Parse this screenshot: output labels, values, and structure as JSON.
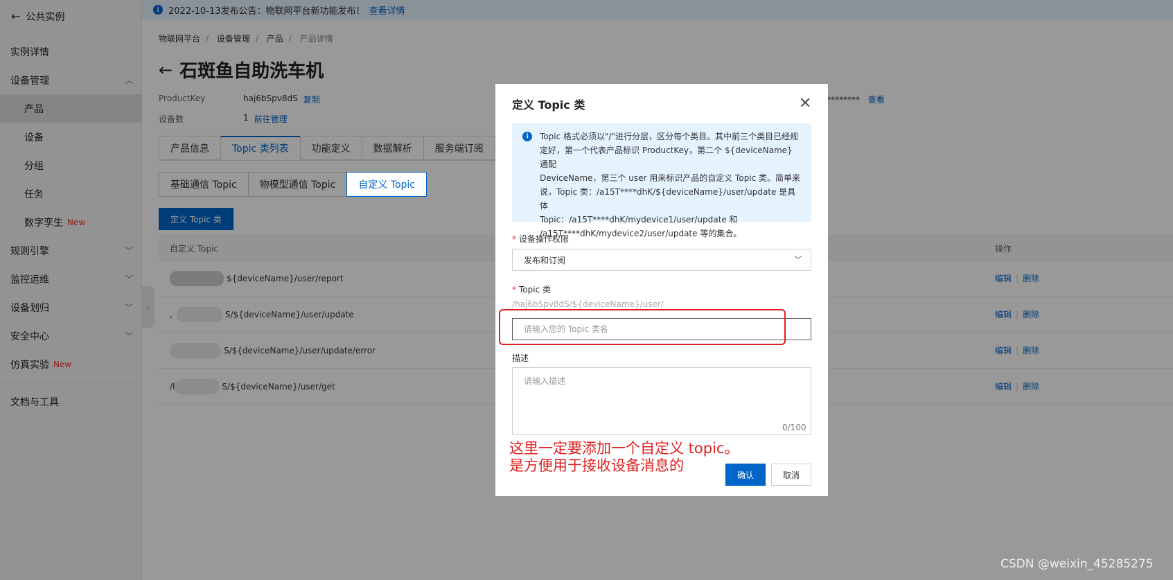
{
  "sidebar": {
    "back_label": "公共实例",
    "items": [
      {
        "label": "实例详情"
      },
      {
        "label": "设备管理",
        "chevron": "up"
      },
      {
        "label": "产品"
      },
      {
        "label": "设备"
      },
      {
        "label": "分组"
      },
      {
        "label": "任务"
      },
      {
        "label": "数字孪生",
        "badge": "New"
      },
      {
        "label": "规则引擎",
        "chevron": "down"
      },
      {
        "label": "监控运维",
        "chevron": "down"
      },
      {
        "label": "设备划归",
        "chevron": "down"
      },
      {
        "label": "安全中心",
        "chevron": "down"
      },
      {
        "label": "仿真实验",
        "badge": "New"
      },
      {
        "label": "文档与工具"
      }
    ]
  },
  "notice": {
    "text": "2022-10-13发布公告：物联网平台新功能发布！",
    "link": "查看详情"
  },
  "breadcrumb": [
    "物联网平台",
    "设备管理",
    "产品",
    "产品详情"
  ],
  "page": {
    "title": "石斑鱼自助洗车机",
    "product_key_label": "ProductKey",
    "product_key": "haj6bSpv8dS",
    "copy": "复制",
    "device_count_label": "设备数",
    "device_count": "1",
    "manage_link": "前往管理",
    "secret_mask": "********",
    "view_link": "查看"
  },
  "tabs": [
    "产品信息",
    "Topic 类列表",
    "功能定义",
    "数据解析",
    "服务端订阅"
  ],
  "subtabs": [
    "基础通信 Topic",
    "物模型通信 Topic",
    "自定义 Topic"
  ],
  "define_button": "定义 Topic 类",
  "table": {
    "col_topic": "自定义 Topic",
    "col_ops": "操作",
    "rows": [
      {
        "prefix": "",
        "topic": "${deviceName}/user/report"
      },
      {
        "prefix": ",",
        "topic": "S/${deviceName}/user/update"
      },
      {
        "prefix": "",
        "topic": "S/${deviceName}/user/update/error"
      },
      {
        "prefix": "/l",
        "topic": "S/${deviceName}/user/get"
      }
    ],
    "edit": "编辑",
    "delete": "删除"
  },
  "dialog": {
    "title": "定义 Topic 类",
    "alert_lines": [
      "Topic 格式必须以\"/\"进行分层，区分每个类目。其中前三个类目已经规",
      "定好，第一个代表产品标识 ProductKey，第二个 ${deviceName} 通配",
      "DeviceName，第三个 user 用来标识产品的自定义 Topic 类。简单来",
      "说，Topic 类：/a15T****dhK/${deviceName}/user/update 是具体",
      "Topic：/a15T****dhK/mydevice1/user/update 和",
      "/a15T****dhK/mydevice2/user/update 等的集合。"
    ],
    "permission_label": "设备操作权限",
    "permission_value": "发布和订阅",
    "topic_label": "Topic 类",
    "topic_prefix": "/haj6bSpv8dS/${deviceName}/user/",
    "topic_placeholder": "请输入您的 Topic 类名",
    "desc_label": "描述",
    "desc_placeholder": "请输入描述",
    "desc_counter": "0/100",
    "annotation_line1": "这里一定要添加一个自定义 topic。",
    "annotation_line2": "是方便用于接收设备消息的",
    "ok": "确认",
    "cancel": "取消"
  },
  "watermark": "CSDN @weixin_45285275"
}
